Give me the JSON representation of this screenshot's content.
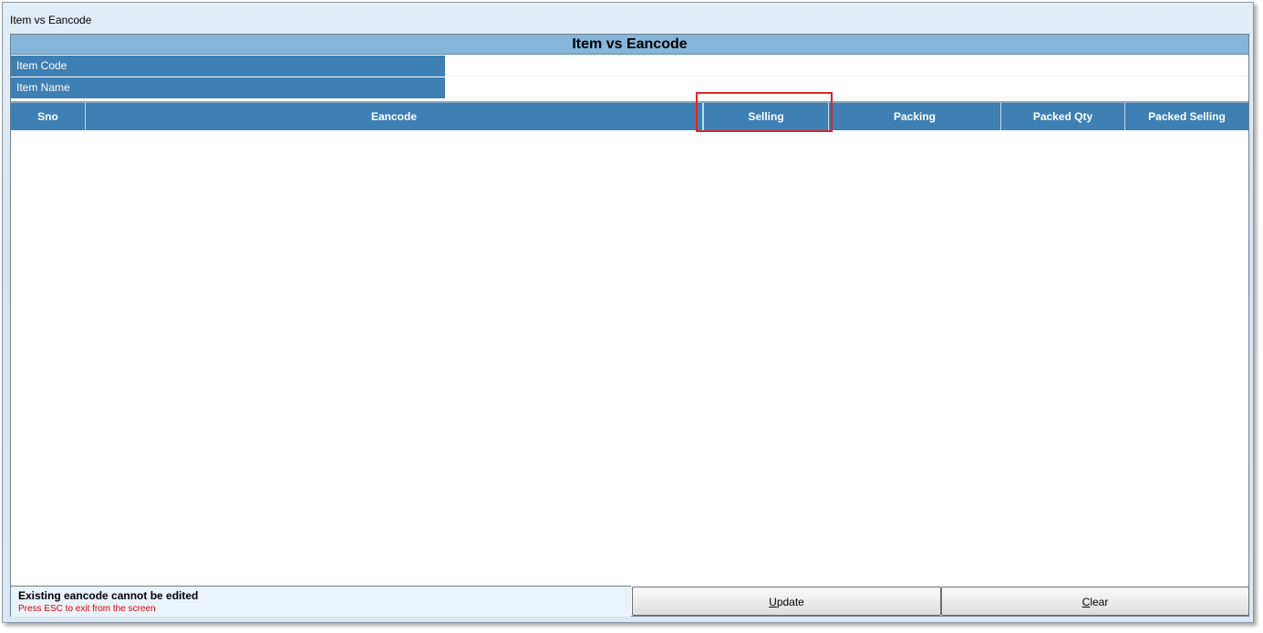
{
  "window": {
    "title": "Item vs Eancode"
  },
  "form": {
    "title": "Item vs Eancode",
    "fields": [
      {
        "label": "Item Code",
        "value": ""
      },
      {
        "label": "Item Name",
        "value": ""
      }
    ]
  },
  "grid": {
    "columns": [
      "Sno",
      "Eancode",
      "Selling",
      "Packing",
      "Packed Qty",
      "Packed Selling"
    ],
    "rows": [],
    "highlighted_column": "Selling"
  },
  "status": {
    "message": "Existing eancode cannot be edited",
    "hint": "Press ESC to exit from the screen"
  },
  "buttons": {
    "update": {
      "mnemonic": "U",
      "rest": "pdate"
    },
    "clear": {
      "mnemonic": "C",
      "rest": "lear"
    }
  },
  "colors": {
    "header_blue": "#3e7fb4",
    "title_bar": "#86b5da",
    "highlight_red": "#d9262b",
    "hint_red": "#e00000"
  }
}
